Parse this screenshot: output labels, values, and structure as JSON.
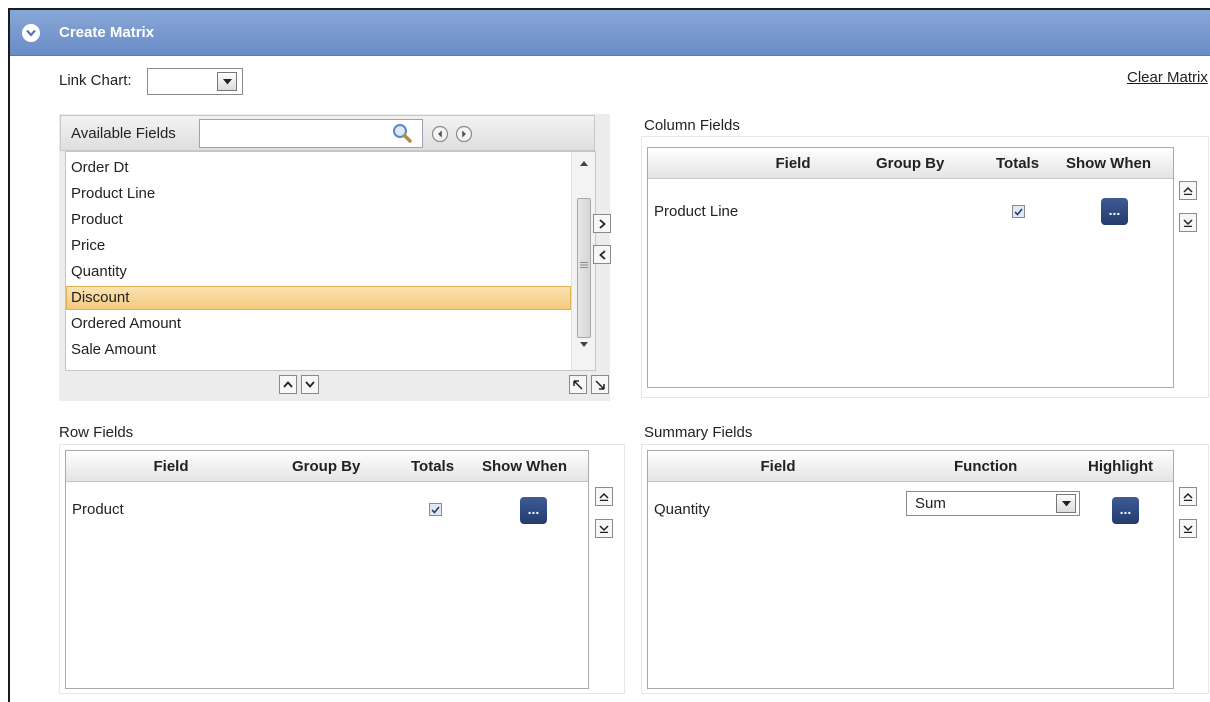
{
  "header": {
    "title": "Create Matrix",
    "collapse_icon": "circle-chevron-down-icon"
  },
  "toolbar": {
    "link_chart_label": "Link Chart:",
    "link_chart_value": "",
    "clear_matrix_label": "Clear Matrix"
  },
  "available_fields": {
    "title": "Available Fields",
    "search_value": "",
    "items": [
      {
        "label": "Order Dt",
        "selected": false
      },
      {
        "label": "Product Line",
        "selected": false
      },
      {
        "label": "Product",
        "selected": false
      },
      {
        "label": "Price",
        "selected": false
      },
      {
        "label": "Quantity",
        "selected": false
      },
      {
        "label": "Discount",
        "selected": true
      },
      {
        "label": "Ordered Amount",
        "selected": false
      },
      {
        "label": "Sale Amount",
        "selected": false
      }
    ]
  },
  "column_fields": {
    "title": "Column Fields",
    "headers": {
      "field": "Field",
      "group_by": "Group By",
      "totals": "Totals",
      "show_when": "Show When"
    },
    "rows": [
      {
        "field": "Product Line",
        "group_by": "",
        "totals": true,
        "show_when_label": "..."
      }
    ]
  },
  "row_fields": {
    "title": "Row Fields",
    "headers": {
      "field": "Field",
      "group_by": "Group By",
      "totals": "Totals",
      "show_when": "Show When"
    },
    "rows": [
      {
        "field": "Product",
        "group_by": "",
        "totals": true,
        "show_when_label": "..."
      }
    ]
  },
  "summary_fields": {
    "title": "Summary Fields",
    "headers": {
      "field": "Field",
      "function": "Function",
      "highlight": "Highlight"
    },
    "rows": [
      {
        "field": "Quantity",
        "function": "Sum",
        "highlight_label": "..."
      }
    ]
  },
  "colors": {
    "header_bar": "#6a8cc6",
    "dots_button": "#2c4478",
    "selected_row": "#f4ca7c"
  }
}
